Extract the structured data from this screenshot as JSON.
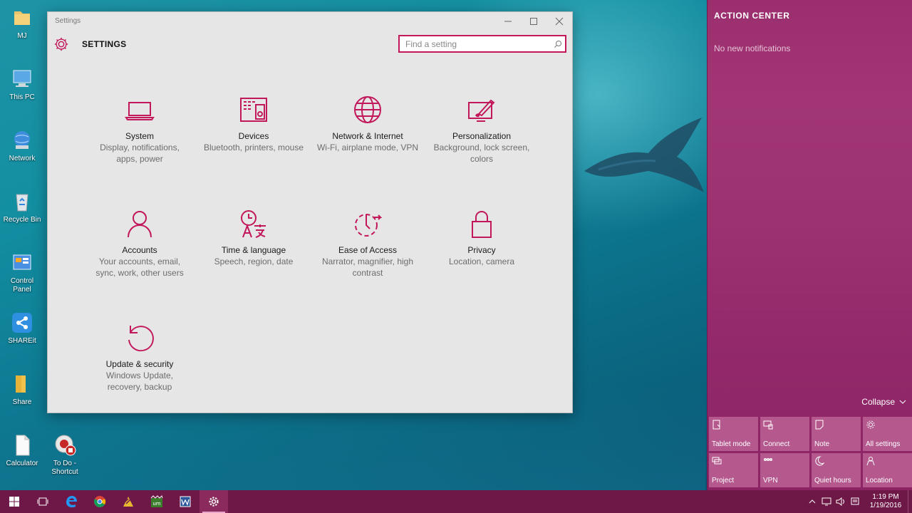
{
  "desktop": {
    "icons": [
      {
        "label": "MJ"
      },
      {
        "label": "This PC"
      },
      {
        "label": "Network"
      },
      {
        "label": "Recycle Bin"
      },
      {
        "label": "Control Panel"
      },
      {
        "label": "SHAREit"
      },
      {
        "label": "Share"
      },
      {
        "label": "Calculator"
      },
      {
        "label": "To Do - Shortcut"
      }
    ]
  },
  "settings_window": {
    "window_title": "Settings",
    "header_title": "SETTINGS",
    "search_placeholder": "Find a setting",
    "accent_color": "#c2185b",
    "tiles": [
      {
        "name": "System",
        "desc": "Display, notifications, apps, power",
        "icon": "laptop-icon"
      },
      {
        "name": "Devices",
        "desc": "Bluetooth, printers, mouse",
        "icon": "devices-icon"
      },
      {
        "name": "Network & Internet",
        "desc": "Wi-Fi, airplane mode, VPN",
        "icon": "globe-icon"
      },
      {
        "name": "Personalization",
        "desc": "Background, lock screen, colors",
        "icon": "paintbrush-icon"
      },
      {
        "name": "Accounts",
        "desc": "Your accounts, email, sync, work, other users",
        "icon": "person-icon"
      },
      {
        "name": "Time & language",
        "desc": "Speech, region, date",
        "icon": "time-language-icon"
      },
      {
        "name": "Ease of Access",
        "desc": "Narrator, magnifier, high contrast",
        "icon": "ease-of-access-icon"
      },
      {
        "name": "Privacy",
        "desc": "Location, camera",
        "icon": "lock-icon"
      },
      {
        "name": "Update & security",
        "desc": "Windows Update, recovery, backup",
        "icon": "refresh-icon"
      }
    ]
  },
  "action_center": {
    "title": "ACTION CENTER",
    "empty_message": "No new notifications",
    "collapse_label": "Collapse",
    "quick_actions": [
      {
        "label": "Tablet mode",
        "icon": "tablet-mode-icon"
      },
      {
        "label": "Connect",
        "icon": "connect-icon"
      },
      {
        "label": "Note",
        "icon": "note-icon"
      },
      {
        "label": "All settings",
        "icon": "gear-icon"
      },
      {
        "label": "Project",
        "icon": "project-icon"
      },
      {
        "label": "VPN",
        "icon": "vpn-icon"
      },
      {
        "label": "Quiet hours",
        "icon": "moon-icon"
      },
      {
        "label": "Location",
        "icon": "location-icon"
      }
    ]
  },
  "taskbar": {
    "time": "1:19 PM",
    "date": "1/19/2016"
  }
}
